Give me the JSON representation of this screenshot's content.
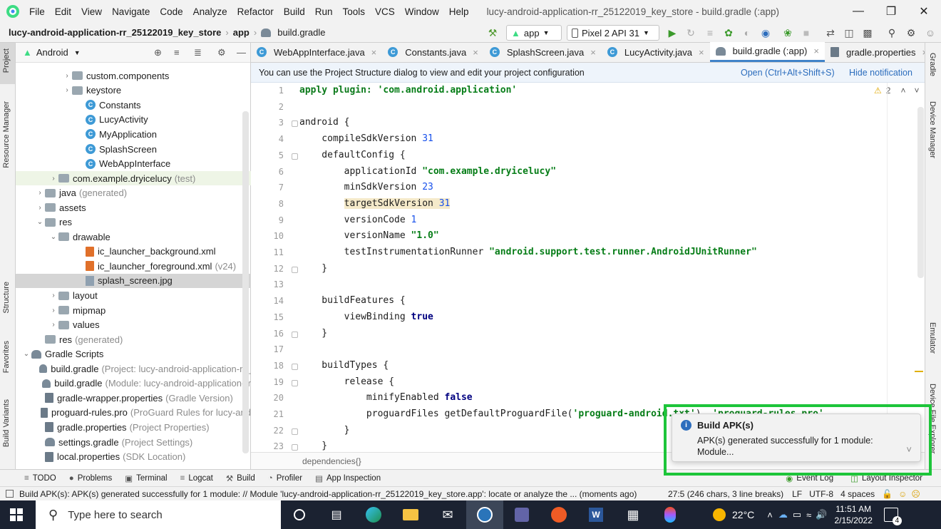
{
  "menubar": {
    "items": [
      "File",
      "Edit",
      "View",
      "Navigate",
      "Code",
      "Analyze",
      "Refactor",
      "Build",
      "Run",
      "Tools",
      "VCS",
      "Window",
      "Help"
    ],
    "title": "lucy-android-application-rr_25122019_key_store - build.gradle (:app)"
  },
  "navbar": {
    "project": "lucy-android-application-rr_25122019_key_store",
    "module": "app",
    "file": "build.gradle",
    "run_config": "app",
    "device": "Pixel 2 API 31"
  },
  "project_panel": {
    "view": "Android",
    "tree": [
      {
        "label": "custom.components",
        "icon": "folder",
        "arrow": "›",
        "indent": 3
      },
      {
        "label": "keystore",
        "icon": "folder",
        "arrow": "›",
        "indent": 3
      },
      {
        "label": "Constants",
        "icon": "class",
        "arrow": "",
        "indent": 4
      },
      {
        "label": "LucyActivity",
        "icon": "class",
        "arrow": "",
        "indent": 4
      },
      {
        "label": "MyApplication",
        "icon": "class",
        "arrow": "",
        "indent": 4
      },
      {
        "label": "SplashScreen",
        "icon": "class",
        "arrow": "",
        "indent": 4
      },
      {
        "label": "WebAppInterface",
        "icon": "class",
        "arrow": "",
        "indent": 4
      },
      {
        "label": "com.example.dryicelucy",
        "muted": "(test)",
        "icon": "folder",
        "arrow": "›",
        "indent": 2,
        "hl": "sel"
      },
      {
        "label": "java",
        "muted": "(generated)",
        "icon": "folder",
        "arrow": "›",
        "indent": 1
      },
      {
        "label": "assets",
        "icon": "folder",
        "arrow": "›",
        "indent": 1
      },
      {
        "label": "res",
        "icon": "folder",
        "arrow": "⌄",
        "indent": 1
      },
      {
        "label": "drawable",
        "icon": "folder",
        "arrow": "⌄",
        "indent": 2
      },
      {
        "label": "ic_launcher_background.xml",
        "icon": "xml",
        "arrow": "",
        "indent": 4
      },
      {
        "label": "ic_launcher_foreground.xml",
        "muted": "(v24)",
        "icon": "xml",
        "arrow": "",
        "indent": 4
      },
      {
        "label": "splash_screen.jpg",
        "icon": "img",
        "arrow": "",
        "indent": 4,
        "hl": "focus"
      },
      {
        "label": "layout",
        "icon": "folder",
        "arrow": "›",
        "indent": 2
      },
      {
        "label": "mipmap",
        "icon": "folder",
        "arrow": "›",
        "indent": 2
      },
      {
        "label": "values",
        "icon": "folder",
        "arrow": "›",
        "indent": 2
      },
      {
        "label": "res",
        "muted": "(generated)",
        "icon": "folder",
        "arrow": "",
        "indent": 1
      },
      {
        "label": "Gradle Scripts",
        "icon": "gradle",
        "arrow": "⌄",
        "indent": 0
      },
      {
        "label": "build.gradle",
        "muted": "(Project: lucy-android-application-rr_",
        "icon": "gradle",
        "arrow": "",
        "indent": 1
      },
      {
        "label": "build.gradle",
        "muted": "(Module: lucy-android-application-rr",
        "icon": "gradle",
        "arrow": "",
        "indent": 1
      },
      {
        "label": "gradle-wrapper.properties",
        "muted": "(Gradle Version)",
        "icon": "props",
        "arrow": "",
        "indent": 1
      },
      {
        "label": "proguard-rules.pro",
        "muted": "(ProGuard Rules for lucy-and",
        "icon": "file",
        "arrow": "",
        "indent": 1
      },
      {
        "label": "gradle.properties",
        "muted": "(Project Properties)",
        "icon": "props",
        "arrow": "",
        "indent": 1
      },
      {
        "label": "settings.gradle",
        "muted": "(Project Settings)",
        "icon": "gradle",
        "arrow": "",
        "indent": 1
      },
      {
        "label": "local.properties",
        "muted": "(SDK Location)",
        "icon": "props",
        "arrow": "",
        "indent": 1
      }
    ]
  },
  "tabs": [
    {
      "label": "WebAppInterface.java",
      "icon": "class"
    },
    {
      "label": "Constants.java",
      "icon": "class"
    },
    {
      "label": "SplashScreen.java",
      "icon": "class"
    },
    {
      "label": "LucyActivity.java",
      "icon": "class"
    },
    {
      "label": "build.gradle (:app)",
      "icon": "gradle",
      "active": true
    },
    {
      "label": "gradle.properties",
      "icon": "props"
    }
  ],
  "notification": {
    "text": "You can use the Project Structure dialog to view and edit your project configuration",
    "open": "Open (Ctrl+Alt+Shift+S)",
    "hide": "Hide notification"
  },
  "editor": {
    "warnings": "2",
    "breadcrumb": "dependencies{}",
    "lines": [
      [
        [
          "kw",
          "apply plugin: "
        ],
        [
          "str",
          "'com.android.application'"
        ]
      ],
      [],
      [
        [
          "t",
          "android {"
        ]
      ],
      [
        [
          "t",
          "    compileSdkVersion "
        ],
        [
          "num",
          "31"
        ]
      ],
      [
        [
          "t",
          "    defaultConfig {"
        ]
      ],
      [
        [
          "t",
          "        applicationId "
        ],
        [
          "str",
          "\"com.example.dryicelucy\""
        ]
      ],
      [
        [
          "t",
          "        minSdkVersion "
        ],
        [
          "num",
          "23"
        ]
      ],
      [
        [
          "hl",
          "        "
        ],
        [
          "hlt",
          "targetSdkVersion "
        ],
        [
          "hlnum",
          "31"
        ]
      ],
      [
        [
          "t",
          "        versionCode "
        ],
        [
          "num",
          "1"
        ]
      ],
      [
        [
          "t",
          "        versionName "
        ],
        [
          "str",
          "\"1.0\""
        ]
      ],
      [
        [
          "t",
          "        testInstrumentationRunner "
        ],
        [
          "str",
          "\"android.support.test.runner.AndroidJUnitRunner\""
        ]
      ],
      [
        [
          "t",
          "    }"
        ]
      ],
      [],
      [
        [
          "t",
          "    buildFeatures {"
        ]
      ],
      [
        [
          "t",
          "        viewBinding "
        ],
        [
          "bk",
          "true"
        ]
      ],
      [
        [
          "t",
          "    }"
        ]
      ],
      [],
      [
        [
          "t",
          "    buildTypes {"
        ]
      ],
      [
        [
          "t",
          "        release {"
        ]
      ],
      [
        [
          "t",
          "            minifyEnabled "
        ],
        [
          "bk",
          "false"
        ]
      ],
      [
        [
          "t",
          "            proguardFiles getDefaultProguardFile("
        ],
        [
          "str",
          "'proguard-android.txt'"
        ],
        [
          "t",
          "), "
        ],
        [
          "str",
          "'proguard-rules.pro'"
        ]
      ],
      [
        [
          "t",
          "        }"
        ]
      ],
      [
        [
          "t",
          "    }"
        ]
      ]
    ]
  },
  "bottom_tools": [
    "TODO",
    "Problems",
    "Terminal",
    "Logcat",
    "Build",
    "Profiler",
    "App Inspection"
  ],
  "bottom_tools_right": [
    "Event Log",
    "Layout Inspector"
  ],
  "status": {
    "message": "Build APK(s): APK(s) generated successfully for 1 module: // Module 'lucy-android-application-rr_25122019_key_store.app': locate or analyze the ... (moments ago)",
    "position": "27:5 (246 chars, 3 line breaks)",
    "line_sep": "LF",
    "encoding": "UTF-8",
    "indent": "4 spaces"
  },
  "popup": {
    "title": "Build APK(s)",
    "line1": "APK(s) generated successfully for 1 module:",
    "line2": "Module..."
  },
  "left_strip": [
    "Project",
    "Resource Manager",
    "Structure",
    "Favorites",
    "Build Variants"
  ],
  "right_strip": [
    "Gradle",
    "Device Manager",
    "Emulator",
    "Device File Explorer"
  ],
  "taskbar": {
    "search_placeholder": "Type here to search",
    "weather": "22°C",
    "time": "11:51 AM",
    "date": "2/15/2022",
    "notif_count": "4"
  },
  "colors": {
    "accent": "#4083c9",
    "highlight_box": "#1dc53a",
    "taskbar": "#1b2231"
  }
}
